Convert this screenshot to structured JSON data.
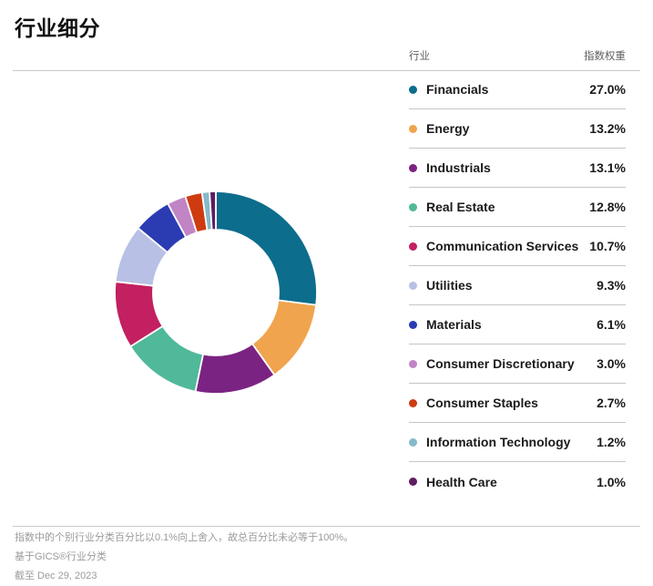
{
  "page": {
    "title": "行业细分"
  },
  "legend_header": {
    "industry": "行业",
    "weight": "指数权重"
  },
  "chart_data": {
    "type": "pie",
    "donut": true,
    "title": "行业细分",
    "categories": [
      "Financials",
      "Energy",
      "Industrials",
      "Real Estate",
      "Communication Services",
      "Utilities",
      "Materials",
      "Consumer Discretionary",
      "Consumer Staples",
      "Information Technology",
      "Health Care"
    ],
    "values": [
      27.0,
      13.2,
      13.1,
      12.8,
      10.7,
      9.3,
      6.1,
      3.0,
      2.7,
      1.2,
      1.0
    ],
    "weight_labels": [
      "27.0%",
      "13.2%",
      "13.1%",
      "12.8%",
      "10.7%",
      "9.3%",
      "6.1%",
      "3.0%",
      "2.7%",
      "1.2%",
      "1.0%"
    ],
    "colors": [
      "#0d6d8c",
      "#f0a44e",
      "#7b2382",
      "#4fb99a",
      "#c22060",
      "#b8c0e5",
      "#2b3cb3",
      "#c184c4",
      "#ce3b10",
      "#85b9ca",
      "#5e1d61"
    ],
    "start_angle_deg": 0,
    "direction": "clockwise",
    "inner_radius_ratio": 0.62,
    "slice_gap_color": "#ffffff",
    "legend_position": "right"
  },
  "footnotes": [
    "指数中的个别行业分类百分比以0.1%向上舍入，故总百分比未必等于100%。",
    "基于GICS®行业分类",
    "截至 Dec 29, 2023"
  ]
}
